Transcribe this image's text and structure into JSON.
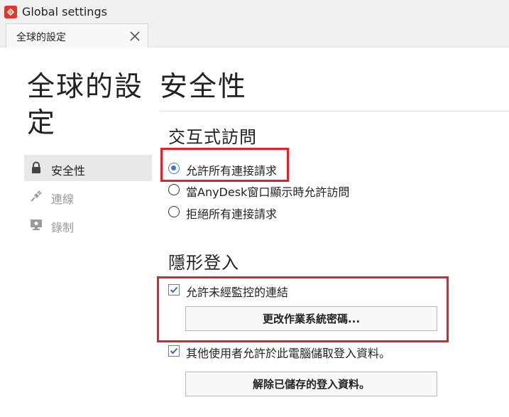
{
  "window": {
    "title": "Global settings",
    "app_icon": "anydesk-logo-icon"
  },
  "tab": {
    "label": "全球的設定",
    "close_icon": "close-icon"
  },
  "sidebar": {
    "title": "全球的設定",
    "items": [
      {
        "label": "安全性",
        "icon": "lock-icon",
        "active": true
      },
      {
        "label": "連線",
        "icon": "plug-icon",
        "active": false
      },
      {
        "label": "錄制",
        "icon": "monitor-icon",
        "active": false
      }
    ]
  },
  "main": {
    "title": "安全性",
    "interactive_access": {
      "heading": "交互式訪問",
      "options": [
        {
          "label": "允許所有連接請求",
          "selected": true
        },
        {
          "label": "當AnyDesk窗口顯示時允許訪問",
          "selected": false
        },
        {
          "label": "拒絕所有連接請求",
          "selected": false
        }
      ]
    },
    "unattended_access": {
      "heading": "隱形登入",
      "allow_unattended_label": "允許未經監控的連結",
      "allow_unattended_checked": true,
      "change_password_button": "更改作業系統密碼...",
      "other_users_label": "其他使用者允許於此電腦儲取登入資料。",
      "other_users_checked": true,
      "clear_credentials_button": "解除已儲存的登入資料。"
    }
  },
  "colors": {
    "highlight": "#e0202a",
    "radio_selected": "#3f74d0",
    "accent": "#e0382f"
  }
}
